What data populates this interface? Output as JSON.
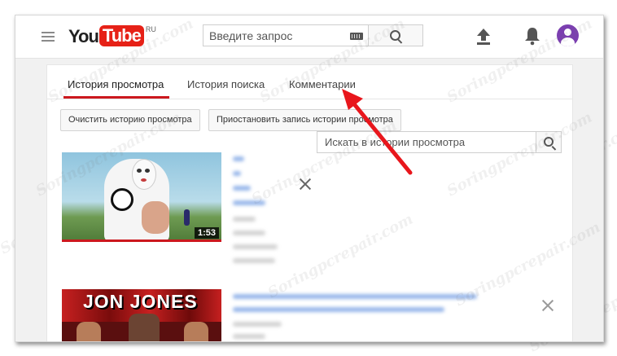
{
  "header": {
    "logo_you": "You",
    "logo_tube": "Tube",
    "logo_region": "RU",
    "search_placeholder": "Введите запрос"
  },
  "tabs": [
    {
      "label": "История просмотра",
      "active": true
    },
    {
      "label": "История поиска",
      "active": false
    },
    {
      "label": "Комментарии",
      "active": false
    }
  ],
  "buttons": {
    "clear_history": "Очистить историю просмотра",
    "pause_history": "Приостановить запись истории просмотра"
  },
  "history_search": {
    "placeholder": "Искать в истории просмотра"
  },
  "videos": [
    {
      "duration": "1:53"
    },
    {
      "thumbnail_text": "JON JONES"
    }
  ],
  "watermark": "Soringpcrepair.com",
  "colors": {
    "accent": "#cc181e",
    "youtube_red": "#e62117",
    "arrow": "#e8161c",
    "avatar": "#7b3fb0"
  }
}
